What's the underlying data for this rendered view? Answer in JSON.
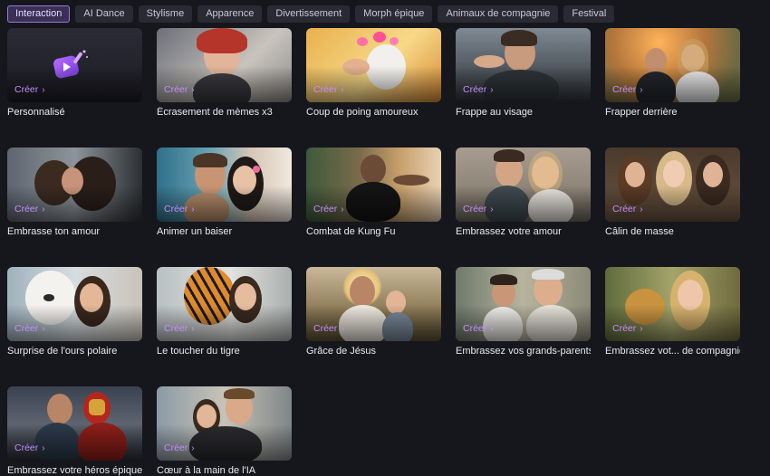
{
  "tabs": [
    {
      "label": "Interaction",
      "active": true
    },
    {
      "label": "AI Dance"
    },
    {
      "label": "Stylisme"
    },
    {
      "label": "Apparence"
    },
    {
      "label": "Divertissement"
    },
    {
      "label": "Morph épique"
    },
    {
      "label": "Animaux de compagnie"
    },
    {
      "label": "Festival"
    }
  ],
  "create_label": "Créer",
  "cards": [
    {
      "title": "Personnalisé"
    },
    {
      "title": "Écrasement de mèmes x3"
    },
    {
      "title": "Coup de poing amoureux"
    },
    {
      "title": "Frappe au visage"
    },
    {
      "title": "Frapper derrière"
    },
    {
      "title": "Embrasse ton amour"
    },
    {
      "title": "Animer un baiser"
    },
    {
      "title": "Combat de Kung Fu"
    },
    {
      "title": "Embrassez votre amour"
    },
    {
      "title": "Câlin de masse"
    },
    {
      "title": "Surprise de l'ours polaire"
    },
    {
      "title": "Le toucher du tigre"
    },
    {
      "title": "Grâce de Jésus"
    },
    {
      "title": "Embrassez vos grands-parents"
    },
    {
      "title": "Embrassez vot... de compagnie"
    },
    {
      "title": "Embrassez votre héros épique"
    },
    {
      "title": "Cœur à la main de l'IA"
    }
  ],
  "colors": {
    "accent": "#c78cff",
    "tab_active_border": "#9b7ad8",
    "background": "#16161d"
  }
}
